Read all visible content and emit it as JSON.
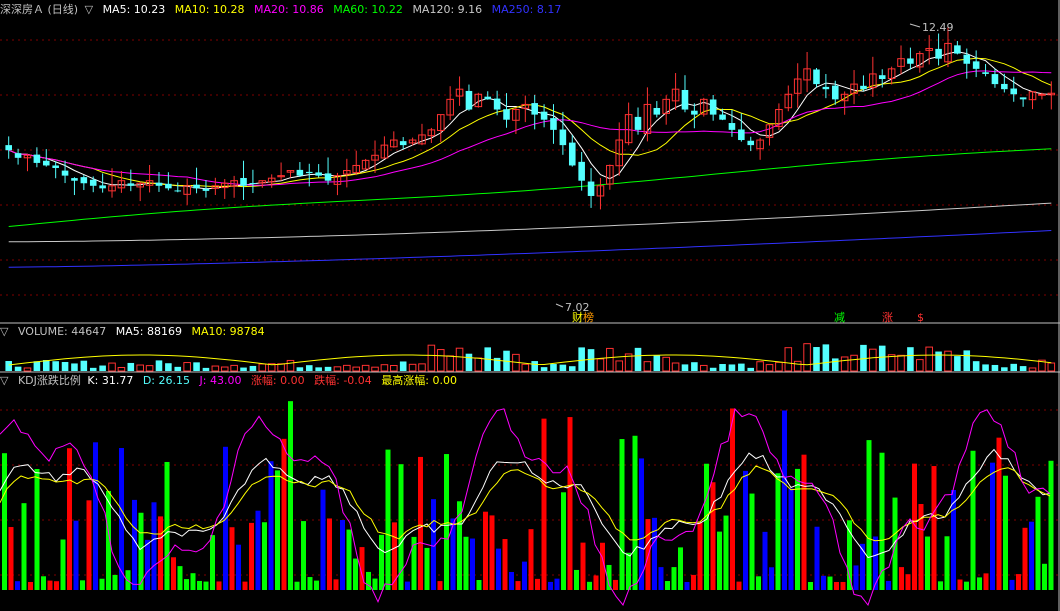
{
  "colors": {
    "up": "#ff3232",
    "down": "#54ffff",
    "ma5": "#ffffff",
    "ma10": "#ffff00",
    "ma20": "#ff00ff",
    "ma60": "#00ff00",
    "ma120": "#c8c8c8",
    "ma250": "#3232ff",
    "k": "#ffffff",
    "d": "#ffff00",
    "j": "#ff00ff",
    "bar_red": "#ff0000",
    "bar_green": "#00ff00",
    "bar_blue": "#0000ff",
    "grid": "#800000",
    "divider": "#c0c0c0"
  },
  "price_panel": {
    "title": "深深房Ａ (日线)",
    "ma5": "MA5: 10.23",
    "ma10": "MA10: 10.28",
    "ma20": "MA20: 10.86",
    "ma60": "MA60: 10.22",
    "ma120": "MA120: 9.16",
    "ma250": "MA250: 8.17",
    "high_label": "12.49",
    "low_label": "7.02",
    "markers": [
      {
        "text": "财",
        "color": "#ffff00"
      },
      {
        "text": "榜",
        "color": "#ff9900"
      },
      {
        "text": "减",
        "color": "#00ff00"
      },
      {
        "text": "涨",
        "color": "#ff3232"
      },
      {
        "text": "$",
        "color": "#ff3232"
      }
    ]
  },
  "volume_panel": {
    "title": "VOLUME: 44647",
    "ma5": "MA5: 88169",
    "ma10": "MA10: 98784"
  },
  "kdj_panel": {
    "title": "KDJ涨跌比例",
    "k": "K: 31.77",
    "d": "D: 26.15",
    "j": "J: 43.00",
    "zf": "涨幅: 0.00",
    "df": "跌幅: -0.04",
    "zgzf": "最高涨幅: 0.00"
  },
  "chart_data": [
    {
      "type": "candlestick",
      "title": "深深房Ａ (日线)",
      "series": [
        {
          "name": "price",
          "close": [
            10.2,
            10.05,
            10.1,
            9.95,
            9.9,
            9.85,
            9.7,
            9.6,
            9.55,
            9.5,
            9.45,
            9.5,
            9.6,
            9.5,
            9.55,
            9.6,
            9.5,
            9.45,
            9.4,
            9.5,
            9.45,
            9.4,
            9.5,
            9.55,
            9.6,
            9.5,
            9.55,
            9.6,
            9.65,
            9.7,
            9.8,
            9.7,
            9.75,
            9.7,
            9.6,
            9.7,
            9.8,
            9.9,
            10.0,
            10.1,
            10.3,
            10.4,
            10.3,
            10.4,
            10.5,
            10.6,
            10.9,
            11.2,
            11.4,
            11.0,
            11.3,
            11.2,
            11.0,
            10.8,
            11.0,
            11.1,
            10.9,
            10.8,
            10.6,
            10.3,
            9.9,
            9.6,
            9.3,
            9.5,
            9.9,
            10.4,
            10.9,
            10.6,
            11.1,
            10.9,
            11.2,
            11.4,
            11.0,
            10.9,
            11.2,
            10.9,
            10.8,
            10.6,
            10.4,
            10.3,
            10.4,
            10.7,
            11.0,
            11.3,
            11.6,
            11.8,
            11.5,
            11.4,
            11.2,
            11.3,
            11.5,
            11.4,
            11.7,
            11.6,
            11.8,
            12.0,
            11.9,
            12.1,
            12.2,
            12.0,
            12.3,
            12.1,
            11.9,
            11.8,
            11.7,
            11.5,
            11.4,
            11.3,
            11.2,
            11.35,
            11.3,
            11.32
          ]
        },
        {
          "name": "MA5",
          "value": 10.23
        },
        {
          "name": "MA10",
          "value": 10.28
        },
        {
          "name": "MA20",
          "value": 10.86
        },
        {
          "name": "MA60",
          "value": 10.22
        },
        {
          "name": "MA120",
          "value": 9.16
        },
        {
          "name": "MA250",
          "value": 8.17
        }
      ],
      "annotations": [
        {
          "text": "12.49",
          "value": 12.49
        },
        {
          "text": "7.02",
          "value": 7.02
        }
      ],
      "ylim": [
        6.9,
        12.8
      ]
    },
    {
      "type": "bar",
      "title": "VOLUME: 44647",
      "series": [
        {
          "name": "VOLUME",
          "value": 44647
        },
        {
          "name": "MA5",
          "value": 88169
        },
        {
          "name": "MA10",
          "value": 98784
        }
      ]
    },
    {
      "type": "bar",
      "title": "KDJ涨跌比例",
      "series": [
        {
          "name": "K",
          "value": 31.77
        },
        {
          "name": "D",
          "value": 26.15
        },
        {
          "name": "J",
          "value": 43.0
        },
        {
          "name": "涨幅",
          "value": 0.0
        },
        {
          "name": "跌幅",
          "value": -0.04
        },
        {
          "name": "最高涨幅",
          "value": 0.0
        }
      ]
    }
  ]
}
